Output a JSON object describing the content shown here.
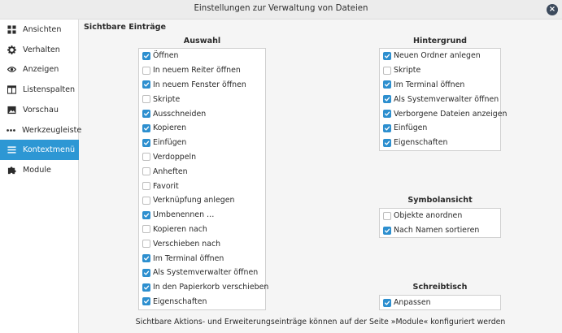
{
  "window": {
    "title": "Einstellungen zur Verwaltung von Dateien",
    "close_glyph": "×"
  },
  "sidebar": {
    "items": [
      {
        "label": "Ansichten",
        "icon": "grid-icon",
        "active": false
      },
      {
        "label": "Verhalten",
        "icon": "gear-icon",
        "active": false
      },
      {
        "label": "Anzeigen",
        "icon": "eye-icon",
        "active": false
      },
      {
        "label": "Listenspalten",
        "icon": "columns-icon",
        "active": false
      },
      {
        "label": "Vorschau",
        "icon": "image-icon",
        "active": false
      },
      {
        "label": "Werkzeugleiste",
        "icon": "dots-icon",
        "active": false
      },
      {
        "label": "Kontextmenü",
        "icon": "menu-icon",
        "active": true
      },
      {
        "label": "Module",
        "icon": "puzzle-icon",
        "active": false
      }
    ]
  },
  "main": {
    "section_title": "Sichtbare Einträge",
    "groups": {
      "auswahl": {
        "title": "Auswahl",
        "items": [
          {
            "label": "Öffnen",
            "checked": true
          },
          {
            "label": "In neuem Reiter öffnen",
            "checked": false
          },
          {
            "label": "In neuem Fenster öffnen",
            "checked": true
          },
          {
            "label": "Skripte",
            "checked": false
          },
          {
            "label": "Ausschneiden",
            "checked": true
          },
          {
            "label": "Kopieren",
            "checked": true
          },
          {
            "label": "Einfügen",
            "checked": true
          },
          {
            "label": "Verdoppeln",
            "checked": false
          },
          {
            "label": "Anheften",
            "checked": false
          },
          {
            "label": "Favorit",
            "checked": false
          },
          {
            "label": "Verknüpfung anlegen",
            "checked": false
          },
          {
            "label": "Umbenennen …",
            "checked": true
          },
          {
            "label": "Kopieren nach",
            "checked": false
          },
          {
            "label": "Verschieben nach",
            "checked": false
          },
          {
            "label": "Im Terminal öffnen",
            "checked": true
          },
          {
            "label": "Als Systemverwalter öffnen",
            "checked": true
          },
          {
            "label": "In den Papierkorb verschieben",
            "checked": true
          },
          {
            "label": "Eigenschaften",
            "checked": true
          }
        ]
      },
      "hintergrund": {
        "title": "Hintergrund",
        "items": [
          {
            "label": "Neuen Ordner anlegen",
            "checked": true
          },
          {
            "label": "Skripte",
            "checked": false
          },
          {
            "label": "Im Terminal öffnen",
            "checked": true
          },
          {
            "label": "Als Systemverwalter öffnen",
            "checked": true
          },
          {
            "label": "Verborgene Dateien anzeigen",
            "checked": true
          },
          {
            "label": "Einfügen",
            "checked": true
          },
          {
            "label": "Eigenschaften",
            "checked": true
          }
        ]
      },
      "symbolansicht": {
        "title": "Symbolansicht",
        "items": [
          {
            "label": "Objekte anordnen",
            "checked": false
          },
          {
            "label": "Nach Namen sortieren",
            "checked": true
          }
        ]
      },
      "schreibtisch": {
        "title": "Schreibtisch",
        "items": [
          {
            "label": "Anpassen",
            "checked": true
          }
        ]
      }
    },
    "footer_note": "Sichtbare Aktions- und Erweiterungseinträge können auf der Seite »Module« konfiguriert werden"
  },
  "colors": {
    "accent": "#2d97d4",
    "checkbox": "#2d8fcf"
  }
}
